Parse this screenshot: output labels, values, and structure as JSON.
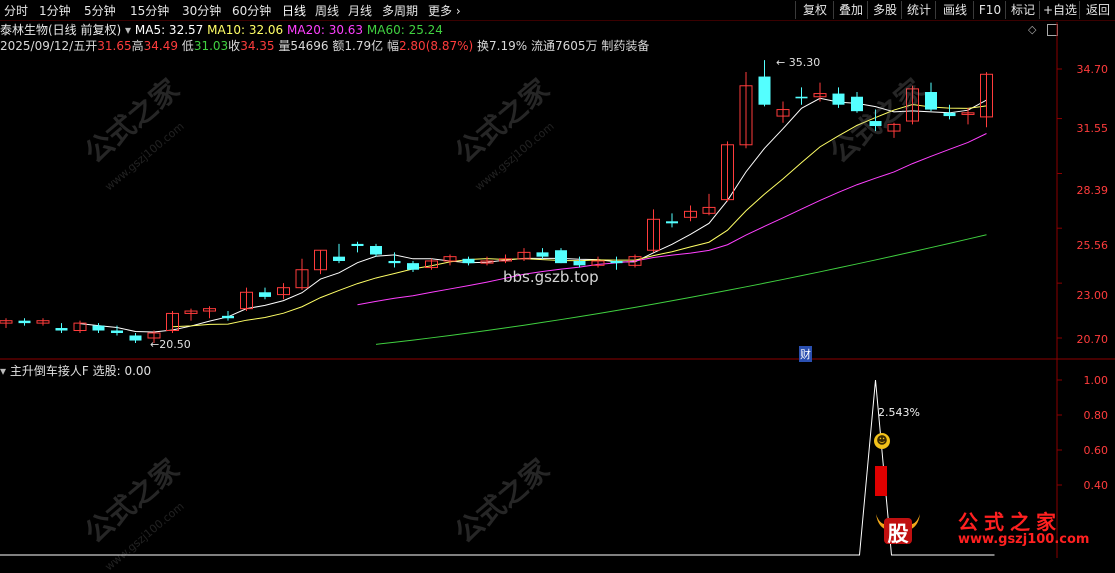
{
  "toolbar": {
    "periods": [
      "分时",
      "1分钟",
      "5分钟",
      "15分钟",
      "30分钟",
      "60分钟",
      "日线",
      "周线",
      "月线",
      "多周期",
      "更多"
    ],
    "active_period": "日线",
    "right_buttons": [
      "复权",
      "叠加",
      "多股",
      "统计",
      "画线",
      "F10",
      "标记",
      "+自选",
      "返回"
    ]
  },
  "header": {
    "stock_name": "泰林生物(日线 前复权)",
    "ma5": "MA5: 32.57",
    "ma10": "MA10: 32.06",
    "ma20": "MA20: 30.63",
    "ma60": "MA60: 25.24"
  },
  "quote": {
    "date": "2025/09/12/五",
    "open_label": "开",
    "open": "31.65",
    "high_label": "高",
    "high": "34.49",
    "low_label": "低",
    "low": "31.03",
    "close_label": "收",
    "close": "34.35",
    "volume": "量54696",
    "amount": "额1.79亿",
    "change_label": "幅",
    "change": "2.80(8.87%)",
    "turnover": "换7.19%",
    "float": "流通7605万",
    "sector": "制药装备"
  },
  "price_axis": [
    "34.70",
    "31.55",
    "28.39",
    "25.56",
    "23.00",
    "20.70"
  ],
  "price_annotations": {
    "high_mark": "35.30",
    "low_mark": "20.50",
    "center_watermark": "bbs.gszb.top",
    "event_marker": "财"
  },
  "indicator": {
    "name": "主升倒车接人F",
    "value": "选股: 0.00",
    "axis": [
      "1.00",
      "0.80",
      "0.60",
      "0.40"
    ],
    "pct_label": "2.543%"
  },
  "watermark": {
    "text": "公式之家",
    "url": "www.gszj100.com",
    "logo_char": "股"
  },
  "colors": {
    "up": "#ff3c3c",
    "down": "#54ffff",
    "ma5": "#ffffff",
    "ma10": "#ffff66",
    "ma20": "#ff40ff",
    "ma60": "#40d040",
    "axis": "#8b0000"
  },
  "candles": [
    [
      21.3,
      21.5,
      21.1,
      21.4
    ],
    [
      21.4,
      21.5,
      21.2,
      21.3
    ],
    [
      21.3,
      21.5,
      21.2,
      21.4
    ],
    [
      21.1,
      21.3,
      20.9,
      21.0
    ],
    [
      21.0,
      21.4,
      20.9,
      21.3
    ],
    [
      21.2,
      21.3,
      20.9,
      21.0
    ],
    [
      21.0,
      21.2,
      20.8,
      20.9
    ],
    [
      20.8,
      20.9,
      20.5,
      20.6
    ],
    [
      20.7,
      21.0,
      20.5,
      20.9
    ],
    [
      21.0,
      21.8,
      20.9,
      21.7
    ],
    [
      21.7,
      21.9,
      21.4,
      21.8
    ],
    [
      21.8,
      22.0,
      21.5,
      21.9
    ],
    [
      21.6,
      21.8,
      21.4,
      21.5
    ],
    [
      21.9,
      22.8,
      21.8,
      22.6
    ],
    [
      22.6,
      22.8,
      22.3,
      22.4
    ],
    [
      22.5,
      23.0,
      22.3,
      22.8
    ],
    [
      22.8,
      24.1,
      22.7,
      23.6
    ],
    [
      23.6,
      24.5,
      23.4,
      24.5
    ],
    [
      24.2,
      24.8,
      23.9,
      24.0
    ],
    [
      24.8,
      24.9,
      24.4,
      24.7
    ],
    [
      24.7,
      24.8,
      24.2,
      24.3
    ],
    [
      24.0,
      24.4,
      23.7,
      23.9
    ],
    [
      23.9,
      24.0,
      23.5,
      23.6
    ],
    [
      23.7,
      24.1,
      23.6,
      24.0
    ],
    [
      24.0,
      24.3,
      23.8,
      24.2
    ],
    [
      24.1,
      24.2,
      23.8,
      23.9
    ],
    [
      23.9,
      24.2,
      23.8,
      24.0
    ],
    [
      24.0,
      24.3,
      23.9,
      24.1
    ],
    [
      24.1,
      24.6,
      24.0,
      24.4
    ],
    [
      24.4,
      24.6,
      24.1,
      24.2
    ],
    [
      24.5,
      24.6,
      23.9,
      23.9
    ],
    [
      24.0,
      24.2,
      23.7,
      23.8
    ],
    [
      23.8,
      24.2,
      23.7,
      24.0
    ],
    [
      24.0,
      24.2,
      23.6,
      23.9
    ],
    [
      23.8,
      24.3,
      23.7,
      24.2
    ],
    [
      24.5,
      26.5,
      24.4,
      26.0
    ],
    [
      25.9,
      26.3,
      25.6,
      25.8
    ],
    [
      26.1,
      26.7,
      25.9,
      26.4
    ],
    [
      26.3,
      27.3,
      26.2,
      26.6
    ],
    [
      27.0,
      30.2,
      26.9,
      30.0
    ],
    [
      30.0,
      34.5,
      29.8,
      33.6
    ],
    [
      34.2,
      35.3,
      32.3,
      32.4
    ],
    [
      31.7,
      32.6,
      31.3,
      32.1
    ],
    [
      32.9,
      33.5,
      32.4,
      32.8
    ],
    [
      32.9,
      33.8,
      32.6,
      33.1
    ],
    [
      33.1,
      33.5,
      32.2,
      32.4
    ],
    [
      32.9,
      33.2,
      31.9,
      32.0
    ],
    [
      31.4,
      32.1,
      30.8,
      31.1
    ],
    [
      30.8,
      31.3,
      30.4,
      31.2
    ],
    [
      31.4,
      33.6,
      31.2,
      33.4
    ],
    [
      33.2,
      33.8,
      32.0,
      32.1
    ],
    [
      31.9,
      32.4,
      31.5,
      31.7
    ],
    [
      31.8,
      32.2,
      31.2,
      31.9
    ],
    [
      31.65,
      34.49,
      31.03,
      34.35
    ]
  ]
}
